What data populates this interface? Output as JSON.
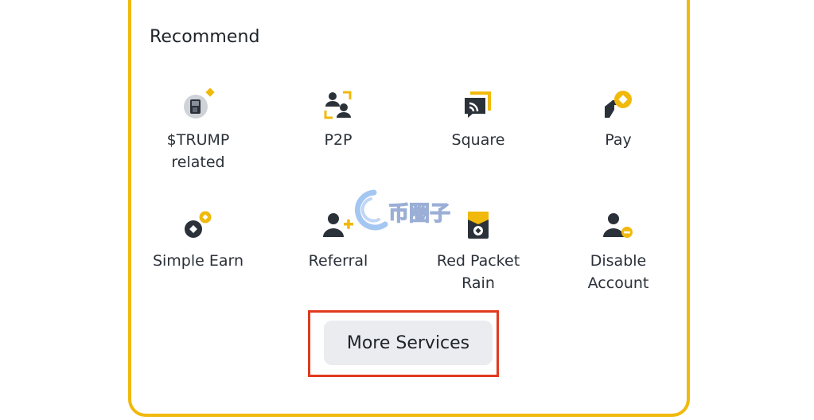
{
  "section": {
    "title": "Recommend"
  },
  "items": [
    {
      "label": "$TRUMP\nrelated",
      "icon": "trump-coin-icon"
    },
    {
      "label": "P2P",
      "icon": "p2p-icon"
    },
    {
      "label": "Square",
      "icon": "square-feed-icon"
    },
    {
      "label": "Pay",
      "icon": "pay-icon"
    },
    {
      "label": "Simple Earn",
      "icon": "simple-earn-icon"
    },
    {
      "label": "Referral",
      "icon": "referral-icon"
    },
    {
      "label": "Red Packet\nRain",
      "icon": "red-packet-icon"
    },
    {
      "label": "Disable\nAccount",
      "icon": "disable-account-icon"
    }
  ],
  "more_button": {
    "label": "More Services"
  },
  "watermark": {
    "text": "币圈子"
  },
  "colors": {
    "accent": "#f0b90b",
    "icon_dark": "#2b3139",
    "highlight": "#e03a1e",
    "button_bg": "#eaecef"
  }
}
